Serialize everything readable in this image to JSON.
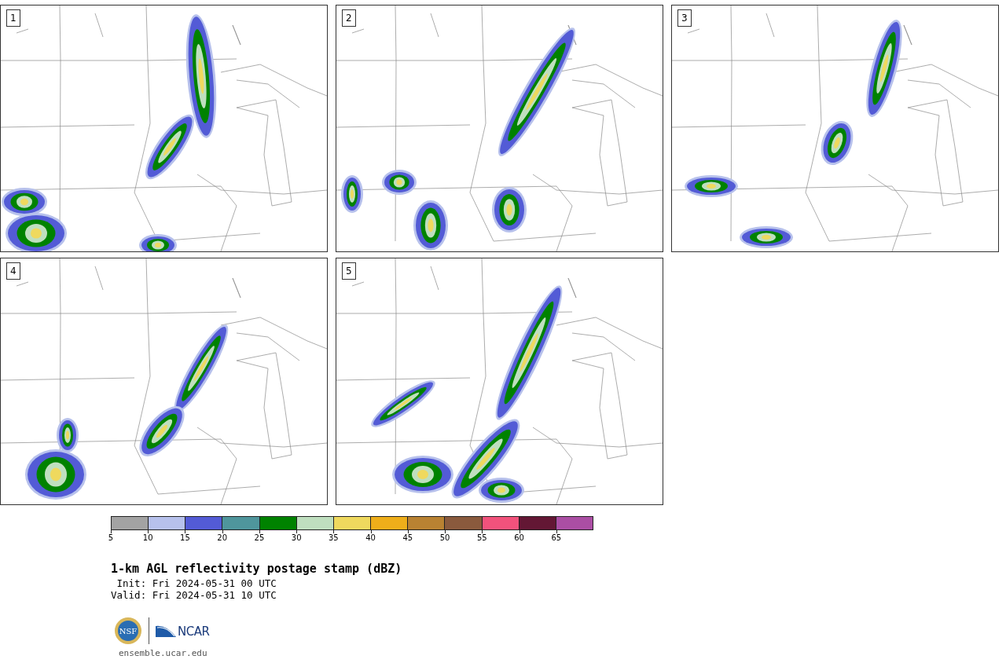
{
  "panels": [
    {
      "label": "1"
    },
    {
      "label": "2"
    },
    {
      "label": "3"
    },
    {
      "label": "4"
    },
    {
      "label": "5"
    }
  ],
  "colorbar": {
    "bins": [
      {
        "color": "#a3a3a3"
      },
      {
        "color": "#b7c1ec"
      },
      {
        "color": "#535bd6"
      },
      {
        "color": "#4f969c"
      },
      {
        "color": "#008200"
      },
      {
        "color": "#bfdfbf"
      },
      {
        "color": "#efd95e"
      },
      {
        "color": "#eeae1a"
      },
      {
        "color": "#b98232"
      },
      {
        "color": "#8a5a3d"
      },
      {
        "color": "#f2527c"
      },
      {
        "color": "#631734"
      },
      {
        "color": "#ab4ea4"
      }
    ],
    "ticks": [
      "5",
      "10",
      "15",
      "20",
      "25",
      "30",
      "35",
      "40",
      "45",
      "50",
      "55",
      "60",
      "65"
    ]
  },
  "title": "1-km AGL reflectivity postage stamp (dBZ)",
  "init": " Init: Fri 2024-05-31 00 UTC",
  "valid": "Valid: Fri 2024-05-31 10 UTC",
  "logos": {
    "nsf": "NSF",
    "ncar": "NCAR"
  },
  "footer_link": "ensemble.ucar.edu"
}
